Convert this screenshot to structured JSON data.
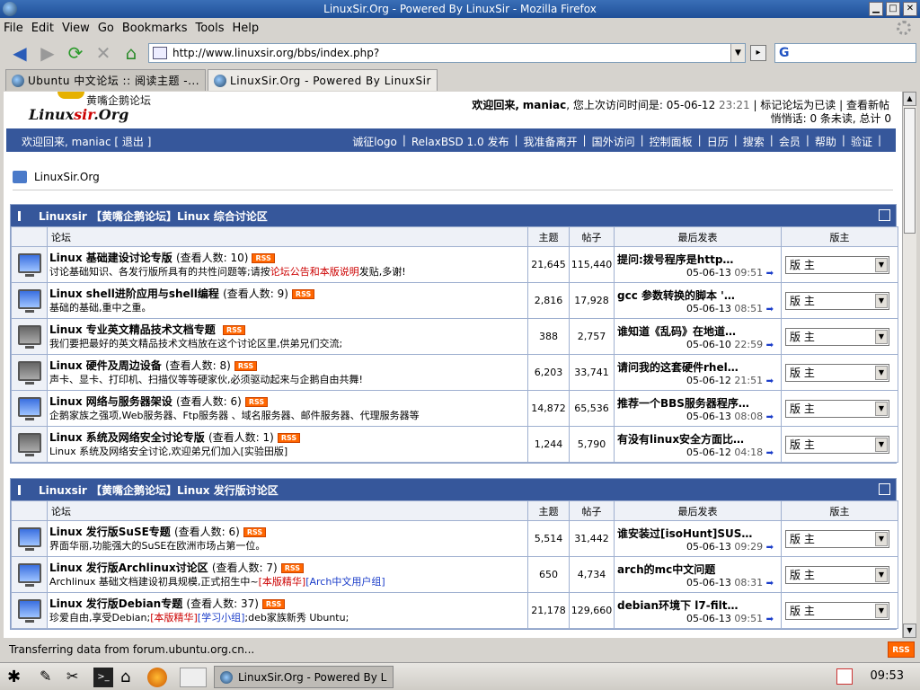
{
  "window": {
    "title": "LinuxSir.Org - Powered By LinuxSir - Mozilla Firefox",
    "btn_min": "▁",
    "btn_max": "□",
    "btn_close": "✕"
  },
  "menu": [
    "File",
    "Edit",
    "View",
    "Go",
    "Bookmarks",
    "Tools",
    "Help"
  ],
  "nav": {
    "url": "http://www.linuxsir.org/bbs/index.php?",
    "search_icon": "G"
  },
  "tabs": [
    {
      "label": "Ubuntu 中文论坛 :: 阅读主题 -..."
    },
    {
      "label": "LinuxSir.Org - Powered By LinuxSir"
    }
  ],
  "header": {
    "logo_top": "黄嘴企鹅论坛",
    "logo_a": "Linux",
    "logo_b": "sir",
    "logo_c": ".Org",
    "welcome_prefix": "欢迎回来,",
    "welcome_user": "maniac",
    "welcome_mid": ", 您上次访问时间是:",
    "last_visit_date": "05-06-12",
    "last_visit_time": "23:21",
    "mark_read": "| 标记论坛为已读",
    "view_new": "| 查看新帖",
    "pm_line": "悄悄话: 0 条未读, 总计 0"
  },
  "topnav": {
    "left": "欢迎回来, maniac [ 退出 ]",
    "links": [
      "诚征logo",
      "RelaxBSD 1.0 发布",
      "我准备离开",
      "国外访问",
      "控制面板",
      "日历",
      "搜索",
      "会员",
      "帮助",
      "验证"
    ]
  },
  "breadcrumb": "LinuxSir.Org",
  "columns": {
    "forum": "论坛",
    "topics": "主题",
    "posts": "帖子",
    "last": "最后发表",
    "mod": "版主"
  },
  "sections": [
    {
      "title": "Linuxsir 【黄嘴企鹅论坛】Linux 综合讨论区",
      "forums": [
        {
          "name": "Linux 基础建设讨论专版",
          "viewers": "(查看人数: 10)",
          "desc_a": "讨论基础知识、各发行版所具有的共性问题等;请按",
          "desc_red": "论坛公告和本版说明",
          "desc_b": "发贴,多谢!",
          "desc_blue": "",
          "desc_c": "",
          "topics": "21,645",
          "posts": "115,440",
          "last_title": "提问:拨号程序是http…",
          "last_date": "05-06-13",
          "last_time": "09:51",
          "mod": "版 主",
          "icon_on": true
        },
        {
          "name": "Linux shell进阶应用与shell编程",
          "viewers": "(查看人数: 9)",
          "desc_a": "基础的基础,重中之重。",
          "desc_red": "",
          "desc_b": "",
          "desc_blue": "",
          "desc_c": "",
          "topics": "2,816",
          "posts": "17,928",
          "last_title": "gcc 参数转换的脚本 '…",
          "last_date": "05-06-13",
          "last_time": "08:51",
          "mod": "版 主",
          "icon_on": true
        },
        {
          "name": "Linux 专业英文精品技术文档专题",
          "viewers": "",
          "desc_a": "我们要把最好的英文精品技术文档放在这个讨论区里,供弟兄们交流;",
          "desc_red": "",
          "desc_b": "",
          "desc_blue": "",
          "desc_c": "",
          "topics": "388",
          "posts": "2,757",
          "last_title": "谁知道《乱码》在地道…",
          "last_date": "05-06-10",
          "last_time": "22:59",
          "mod": "版 主",
          "icon_on": false
        },
        {
          "name": "Linux 硬件及周边设备",
          "viewers": "(查看人数: 8)",
          "desc_a": "声卡、显卡、打印机、扫描仪等等硬家伙,必须驱动起来与企鹅自由共舞!",
          "desc_red": "",
          "desc_b": "",
          "desc_blue": "",
          "desc_c": "",
          "topics": "6,203",
          "posts": "33,741",
          "last_title": "请问我的这套硬件rhel…",
          "last_date": "05-06-12",
          "last_time": "21:51",
          "mod": "版 主",
          "icon_on": false
        },
        {
          "name": "Linux 网络与服务器架设",
          "viewers": "(查看人数: 6)",
          "desc_a": "企鹅家族之强项,Web服务器、Ftp服务器 、域名服务器、邮件服务器、代理服务器等",
          "desc_red": "",
          "desc_b": "",
          "desc_blue": "",
          "desc_c": "",
          "topics": "14,872",
          "posts": "65,536",
          "last_title": "推荐一个BBS服务器程序…",
          "last_date": "05-06-13",
          "last_time": "08:08",
          "mod": "版 主",
          "icon_on": true
        },
        {
          "name": "Linux 系统及网络安全讨论专版",
          "viewers": "(查看人数: 1)",
          "desc_a": "Linux 系统及网络安全讨论,欢迎弟兄们加入[实验田版]",
          "desc_red": "",
          "desc_b": "",
          "desc_blue": "",
          "desc_c": "",
          "topics": "1,244",
          "posts": "5,790",
          "last_title": "有没有linux安全方面比…",
          "last_date": "05-06-12",
          "last_time": "04:18",
          "mod": "版 主",
          "icon_on": false
        }
      ]
    },
    {
      "title": "Linuxsir 【黄嘴企鹅论坛】Linux 发行版讨论区",
      "forums": [
        {
          "name": "Linux 发行版SuSE专题",
          "viewers": "(查看人数: 6)",
          "desc_a": "界面华丽,功能强大的SuSE在欧洲市场占第一位。",
          "desc_red": "",
          "desc_b": "",
          "desc_blue": "",
          "desc_c": "",
          "topics": "5,514",
          "posts": "31,442",
          "last_title": "谁安装过[isoHunt]SUS…",
          "last_date": "05-06-13",
          "last_time": "09:29",
          "mod": "版 主",
          "icon_on": true
        },
        {
          "name": "Linux 发行版Archlinux讨论区",
          "viewers": "(查看人数: 7)",
          "desc_a": "Archlinux 基础文档建设初具规模,正式招生中~",
          "desc_red": "[本版精华]",
          "desc_b": "",
          "desc_blue": "[Arch中文用户组]",
          "desc_c": "",
          "topics": "650",
          "posts": "4,734",
          "last_title": "arch的mc中文问题",
          "last_date": "05-06-13",
          "last_time": "08:31",
          "mod": "版 主",
          "icon_on": true
        },
        {
          "name": "Linux 发行版Debian专题",
          "viewers": "(查看人数: 37)",
          "desc_a": "珍爱自由,享受Debian;",
          "desc_red": "[本版精华]",
          "desc_b": "",
          "desc_blue": "[学习小组]",
          "desc_c": ";deb家族新秀 Ubuntu;",
          "topics": "21,178",
          "posts": "129,660",
          "last_title": "debian环境下 l7-filt…",
          "last_date": "05-06-13",
          "last_time": "09:51",
          "mod": "版 主",
          "icon_on": true
        }
      ]
    }
  ],
  "status": {
    "text": "Transferring data from forum.ubuntu.org.cn...",
    "rss": "RSS"
  },
  "taskbar": {
    "task": "LinuxSir.Org - Powered By L",
    "clock": "09:53"
  },
  "colors": {
    "accent": "#36579b",
    "rss": "#ff6600"
  }
}
